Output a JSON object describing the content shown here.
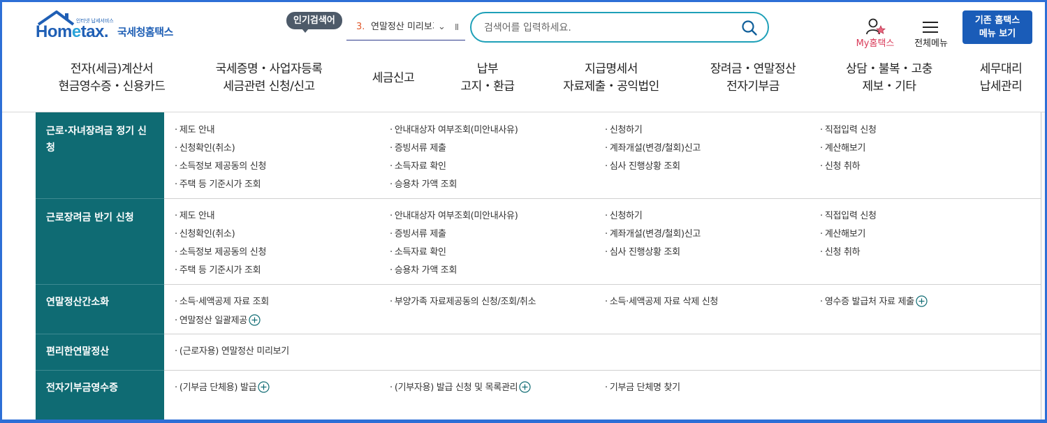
{
  "header": {
    "logo_small": "인터넷 납세서비스",
    "logo_main_left": "Hom",
    "logo_main_e": "e",
    "logo_main_right": "tax.",
    "logo_kr": "국세청홈택스",
    "popular_badge": "인기검색어",
    "popular_rank": "3.",
    "popular_term": "연말정산 미리보기",
    "popular_chevron": "⌄",
    "popular_pause": "II",
    "search_placeholder": "검색어를 입력하세요.",
    "my_hometax": "My홈택스",
    "all_menu": "전체메뉴",
    "legacy_line1": "기존 홈택스",
    "legacy_line2": "메뉴 보기"
  },
  "nav": [
    {
      "line1": "전자(세금)계산서",
      "line2": "현금영수증・신용카드"
    },
    {
      "line1": "국세증명・사업자등록",
      "line2": "세금관련 신청/신고"
    },
    {
      "line1": "세금신고",
      "line2": ""
    },
    {
      "line1": "납부",
      "line2": "고지・환급"
    },
    {
      "line1": "지급명세서",
      "line2": "자료제출・공익법인"
    },
    {
      "line1": "장려금・연말정산",
      "line2": "전자기부금"
    },
    {
      "line1": "상담・불복・고충",
      "line2": "제보・기타"
    },
    {
      "line1": "세무대리",
      "line2": "납세관리"
    }
  ],
  "rows": [
    {
      "title": "근로·자녀장려금 정기 신청",
      "items": [
        [
          "제도 안내",
          "안내대상자 여부조회(미안내사유)",
          "신청하기",
          "직접입력 신청"
        ],
        [
          "신청확인(취소)",
          "증빙서류 제출",
          "계좌개설(변경/철회)신고",
          "계산해보기"
        ],
        [
          "소득정보 제공동의 신청",
          "소득자료 확인",
          "심사 진행상황 조회",
          "신청 취하"
        ],
        [
          "주택 등 기준시가 조회",
          "승용차 가액 조회"
        ]
      ]
    },
    {
      "title": "근로장려금 반기 신청",
      "items": [
        [
          "제도 안내",
          "안내대상자 여부조회(미안내사유)",
          "신청하기",
          "직접입력 신청"
        ],
        [
          "신청확인(취소)",
          "증빙서류 제출",
          "계좌개설(변경/철회)신고",
          "계산해보기"
        ],
        [
          "소득정보 제공동의 신청",
          "소득자료 확인",
          "심사 진행상황 조회",
          "신청 취하"
        ],
        [
          "주택 등 기준시가 조회",
          "승용차 가액 조회"
        ]
      ]
    },
    {
      "title": "연말정산간소화",
      "items": [
        [
          "소득·세액공제 자료 조회",
          "부양가족 자료제공동의 신청/조회/취소",
          "소득·세액공제 자료 삭제 신청",
          "영수증 발급처 자료 제출"
        ],
        [
          "연말정산 일괄제공"
        ]
      ]
    },
    {
      "title": "편리한연말정산",
      "items": [
        [
          "(근로자용) 연말정산 미리보기"
        ]
      ]
    },
    {
      "title": "전자기부금영수증",
      "items": [
        [
          "(기부금 단체용) 발급",
          "(기부자용) 발급 신청 및 목록관리",
          "기부금 단체명 찾기"
        ]
      ]
    }
  ],
  "colors": {
    "brand_blue": "#1a5cb8",
    "teal_header": "#0f6b73",
    "search_border": "#1ea0b8",
    "accent_red": "#d93c5a"
  }
}
